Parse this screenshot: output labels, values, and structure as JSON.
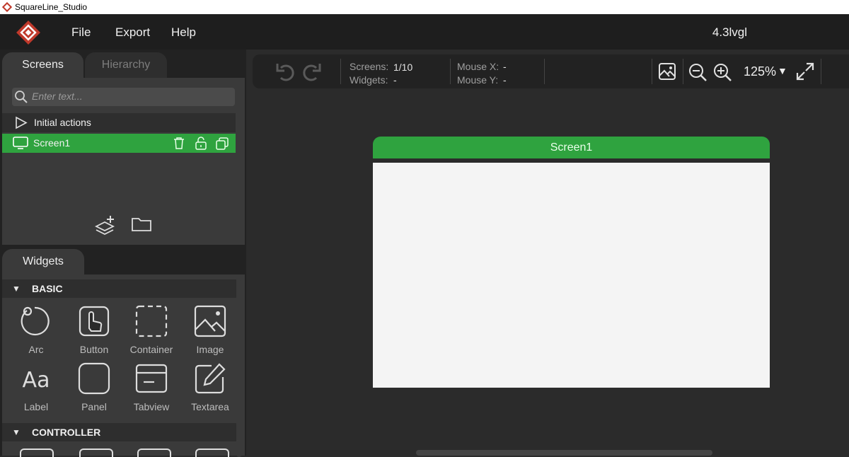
{
  "window": {
    "title": "SquareLine_Studio"
  },
  "menu": {
    "items": [
      "File",
      "Export",
      "Help"
    ],
    "version": "4.3lvgl"
  },
  "screens_panel": {
    "tabs": [
      "Screens",
      "Hierarchy"
    ],
    "search_placeholder": "Enter text...",
    "items": [
      {
        "label": "Initial actions",
        "icon": "play-icon"
      },
      {
        "label": "Screen1",
        "icon": "monitor-icon",
        "selected": true
      }
    ]
  },
  "toolbar": {
    "screens_label": "Screens:",
    "screens_value": "1/10",
    "widgets_label": "Widgets:",
    "widgets_value": "-",
    "mouse_x_label": "Mouse X:",
    "mouse_x_value": "-",
    "mouse_y_label": "Mouse Y:",
    "mouse_y_value": "-",
    "zoom": "125%"
  },
  "canvas": {
    "screen_title": "Screen1"
  },
  "widgets_panel": {
    "tab": "Widgets",
    "sections": [
      "BASIC",
      "CONTROLLER"
    ],
    "basic": [
      "Arc",
      "Button",
      "Container",
      "Image",
      "Label",
      "Panel",
      "Tabview",
      "Textarea"
    ]
  },
  "colors": {
    "accent_green": "#2fa33f",
    "background": "#2b2b2b",
    "panel": "#3a3a3a"
  }
}
